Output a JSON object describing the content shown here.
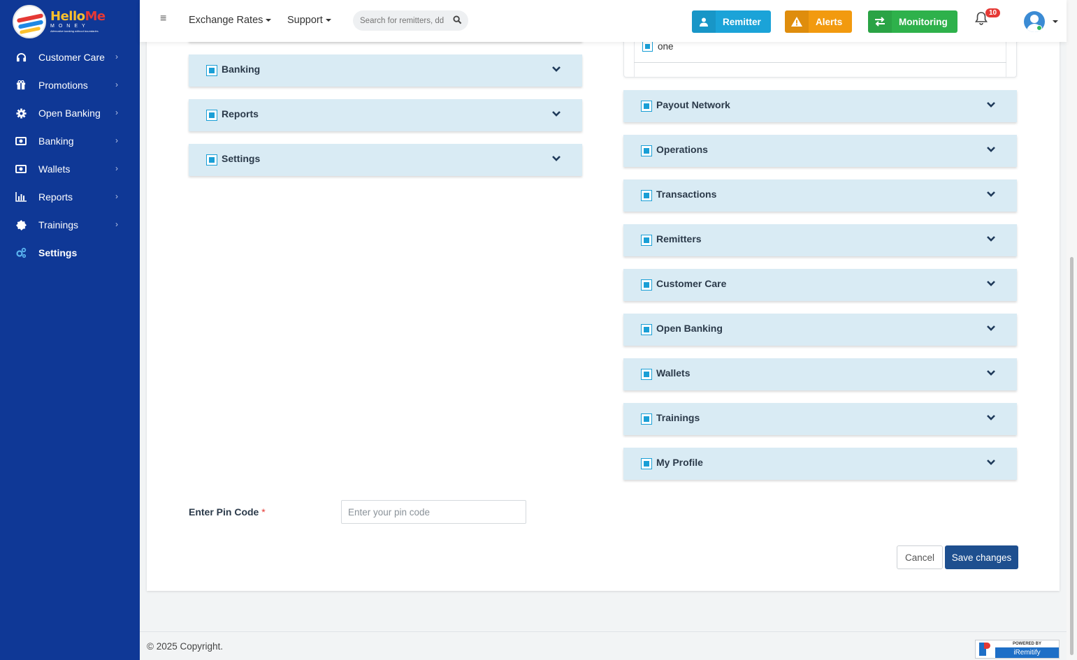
{
  "brand": {
    "name_part1": "Hello",
    "name_part2": "Me",
    "sub": "MONEY",
    "tagline": "Alternative banking without boundaries"
  },
  "sidebar": {
    "items": [
      {
        "label": "Customer Care",
        "icon": "headset-icon"
      },
      {
        "label": "Promotions",
        "icon": "gift-icon"
      },
      {
        "label": "Open Banking",
        "icon": "gear-icon"
      },
      {
        "label": "Banking",
        "icon": "money-icon"
      },
      {
        "label": "Wallets",
        "icon": "money-icon"
      },
      {
        "label": "Reports",
        "icon": "bar-chart-icon"
      },
      {
        "label": "Trainings",
        "icon": "badge-icon"
      },
      {
        "label": "Settings",
        "icon": "gears-icon",
        "active": true
      }
    ]
  },
  "topbar": {
    "menu": [
      "Exchange Rates",
      "Support"
    ],
    "search_placeholder": "Search for remitters, dd",
    "buttons": [
      {
        "label": "Remitter",
        "icon": "user-icon",
        "color": "#1ba3d8"
      },
      {
        "label": "Alerts",
        "icon": "warning-icon",
        "color": "#f29a0f"
      },
      {
        "label": "Monitoring",
        "icon": "exchange-icon",
        "color": "#2eb14b"
      }
    ],
    "notification_count": "10"
  },
  "left_panels": [
    "Banking",
    "Reports",
    "Settings"
  ],
  "right_subitem": "one",
  "right_panels": [
    "Payout Network",
    "Operations",
    "Transactions",
    "Remitters",
    "Customer Care",
    "Open Banking",
    "Wallets",
    "Trainings",
    "My Profile"
  ],
  "form": {
    "pin_label": "Enter Pin Code",
    "required_mark": "*",
    "pin_placeholder": "Enter your pin code",
    "cancel_label": "Cancel",
    "save_label": "Save changes"
  },
  "footer": {
    "copyright": "© 2025 Copyright.",
    "powered_by": "POWERED BY",
    "powered_name": "iRemitify"
  }
}
